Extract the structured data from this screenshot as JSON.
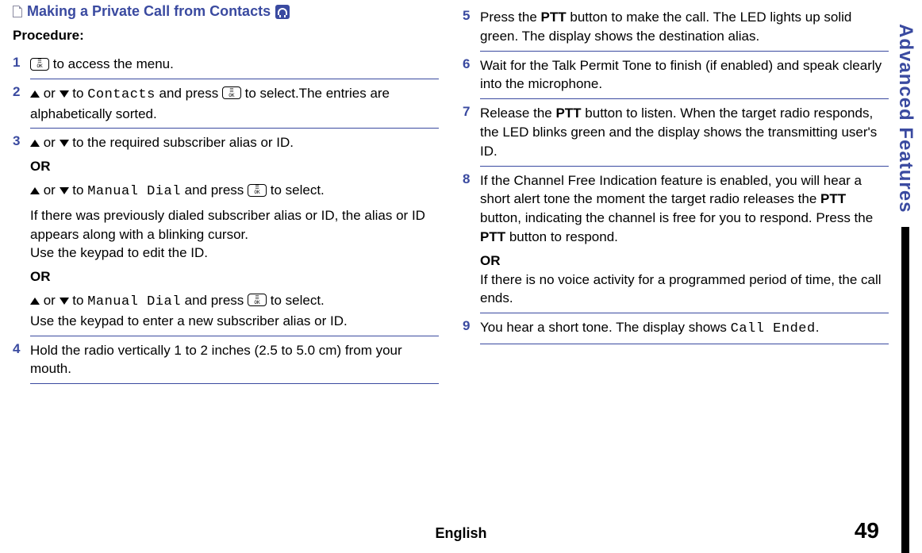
{
  "title": "Making a Private Call from Contacts",
  "procedure_label": "Procedure:",
  "steps": {
    "s1": {
      "num": "1",
      "t1": " to access the menu."
    },
    "s2": {
      "num": "2",
      "or": " or ",
      "to": " to ",
      "contacts": "Contacts",
      "press": " and press ",
      "tail": " to select.The entries are alphabetically sorted."
    },
    "s3": {
      "num": "3",
      "l1_or": " or ",
      "l1_to": " to the required subscriber alias or ID.",
      "OR": "OR",
      "l2_or": " or ",
      "l2_to": " to ",
      "manual": "Manual Dial",
      "l2_press": " and press ",
      "l2_tail": " to select.",
      "l3": "If there was previously dialed subscriber alias or ID, the alias or ID appears along with a blinking cursor.",
      "l4": "Use the keypad to edit the ID.",
      "l5_or": " or ",
      "l5_to": " to ",
      "l5_press": " and press ",
      "l5_tail": " to select.",
      "l6": "Use the keypad to enter a new subscriber alias or ID."
    },
    "s4": {
      "num": "4",
      "text": "Hold the radio vertically 1 to 2 inches (2.5 to 5.0 cm) from your mouth."
    },
    "s5": {
      "num": "5",
      "p1": "Press the ",
      "ptt": "PTT",
      "p2": " button to make the call. The LED lights up solid green. The display shows the destination alias."
    },
    "s6": {
      "num": "6",
      "text": "Wait for the Talk Permit Tone to finish (if enabled) and speak clearly into the microphone."
    },
    "s7": {
      "num": "7",
      "p1": "Release the ",
      "ptt": "PTT",
      "p2": " button to listen. When the target radio responds, the LED blinks green and the display shows the transmitting user's ID."
    },
    "s8": {
      "num": "8",
      "p1": "If the Channel Free Indication feature is enabled, you will hear a short alert tone the moment the target radio releases the ",
      "ptt": "PTT",
      "p2": " button, indicating the channel is free for you to respond. Press the ",
      "p3": " button to respond.",
      "OR": "OR",
      "p4": "If there is no voice activity for a programmed period of time, the call ends."
    },
    "s9": {
      "num": "9",
      "p1": "You hear a short tone. The display shows ",
      "ended": "Call Ended",
      "dot": "."
    }
  },
  "side_label": "Advanced Features",
  "page_number": "49",
  "language": "English"
}
